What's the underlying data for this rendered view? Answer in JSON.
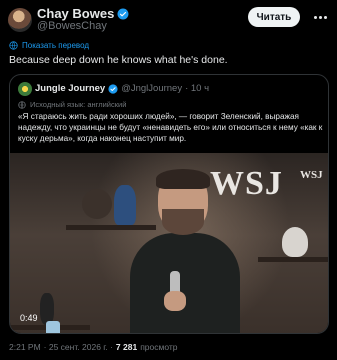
{
  "author": {
    "name": "Chay Bowes",
    "handle": "@BowesChay",
    "follow_label": "Читать"
  },
  "translate_label": "Показать перевод",
  "tweet_text": "Because deep down he knows what he's done.",
  "quote": {
    "name": "Jungle Journey",
    "handle": "@JnglJourney",
    "time": "· 10 ч",
    "lang_label": "Исходный язык: английский",
    "text": "«Я стараюсь жить ради хороших людей», — говорит Зеленский, выражая надежду, что украинцы не будут «ненавидеть его» или относиться к нему «как к куску дерьма», когда наконец наступит мир.",
    "video": {
      "brand": "WSJ",
      "brand_small": "WSJ",
      "time": "0:49"
    }
  },
  "footer": {
    "time": "2:21 PM",
    "date": "· 25 сент. 2026 г. ·",
    "views": "7 281",
    "views_label": "просмотр"
  },
  "colors": {
    "accent": "#1d9bf0",
    "verified": "#1d9bf0",
    "background": "#000000"
  }
}
